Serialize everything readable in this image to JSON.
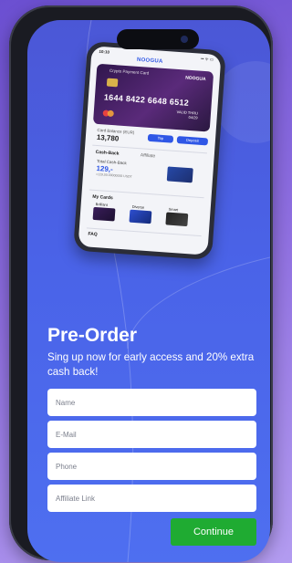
{
  "form": {
    "title": "Pre-Order",
    "subtitle": "Sing up now for early access and 20% extra cash back!",
    "fields": [
      {
        "placeholder": "Name",
        "value": ""
      },
      {
        "placeholder": "E-Mail",
        "value": ""
      },
      {
        "placeholder": "Phone",
        "value": ""
      },
      {
        "placeholder": "Affiliate Link",
        "value": ""
      }
    ],
    "continue_label": "Continue"
  },
  "mockup": {
    "status_time": "10:10",
    "status_icons": "▪▪ ᯤ ▭",
    "logo": "NOOGUA",
    "card": {
      "type_label": "Crypto Payment Card",
      "brand": "NOOGUA",
      "number": "1644 8422 6648 6512",
      "valid_label": "VALID THRU",
      "valid_date": "04/29"
    },
    "balance_label": "Card Balance (EUR)",
    "balance_value": "13,780",
    "top_up_label": "Top",
    "deposit_label": "Deposit",
    "tab_cashback": "Cash-Back",
    "tab_affiliate": "Affiliate",
    "cashback_label": "Total Cash-Back",
    "cashback_value": "129,-",
    "cashback_sub": "=129,00.00000000 USDT",
    "my_cards_label": "My Cards",
    "card_types": [
      "Brilliant",
      "Diverse",
      "Smart"
    ],
    "faq_label": "FAQ"
  },
  "colors": {
    "screen_bg": "#4a63e8",
    "accent_green": "#1fab32",
    "brand_blue": "#2f57e6"
  }
}
